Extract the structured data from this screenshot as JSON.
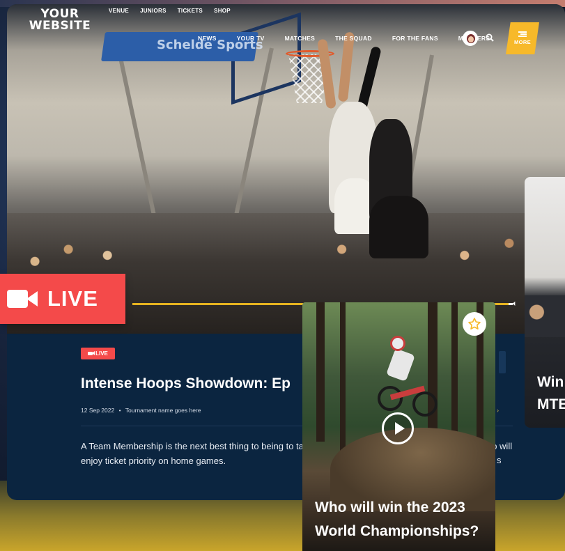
{
  "site": {
    "logo_line1": "YOUR",
    "logo_line2": "WEBSITE"
  },
  "util_nav": [
    "VENUE",
    "JUNIORS",
    "TICKETS",
    "SHOP"
  ],
  "main_nav": [
    "NEWS",
    "YOUR TV",
    "MATCHES",
    "THE SQUAD",
    "FOR THE FANS",
    "MEMBERS"
  ],
  "more_label": "MORE",
  "hero": {
    "banner_text": "Schelde Sports",
    "live_label": "LIVE"
  },
  "article": {
    "badge": "LIVE",
    "headline": "Intense Hoops Showdown: Ep",
    "date": "12 Sep 2022",
    "separator": "•",
    "tournament": "Tournament name goes here",
    "body": "A Team Membership is the next best thing to being to take advantage of a range of benefits when suppo will enjoy ticket priority on home games.",
    "tail": "s"
  },
  "peek_card": {
    "line1": "Win",
    "line2": "MTE"
  },
  "video_card": {
    "title": "Who will win the 2023 World Championships?"
  },
  "colors": {
    "live_red": "#f44a4a",
    "accent_yellow": "#f7b92a",
    "card_navy": "#0b2540"
  },
  "icons": [
    "search-icon",
    "camera-icon",
    "play-icon",
    "star-icon",
    "menu-icon",
    "volume-icon"
  ]
}
